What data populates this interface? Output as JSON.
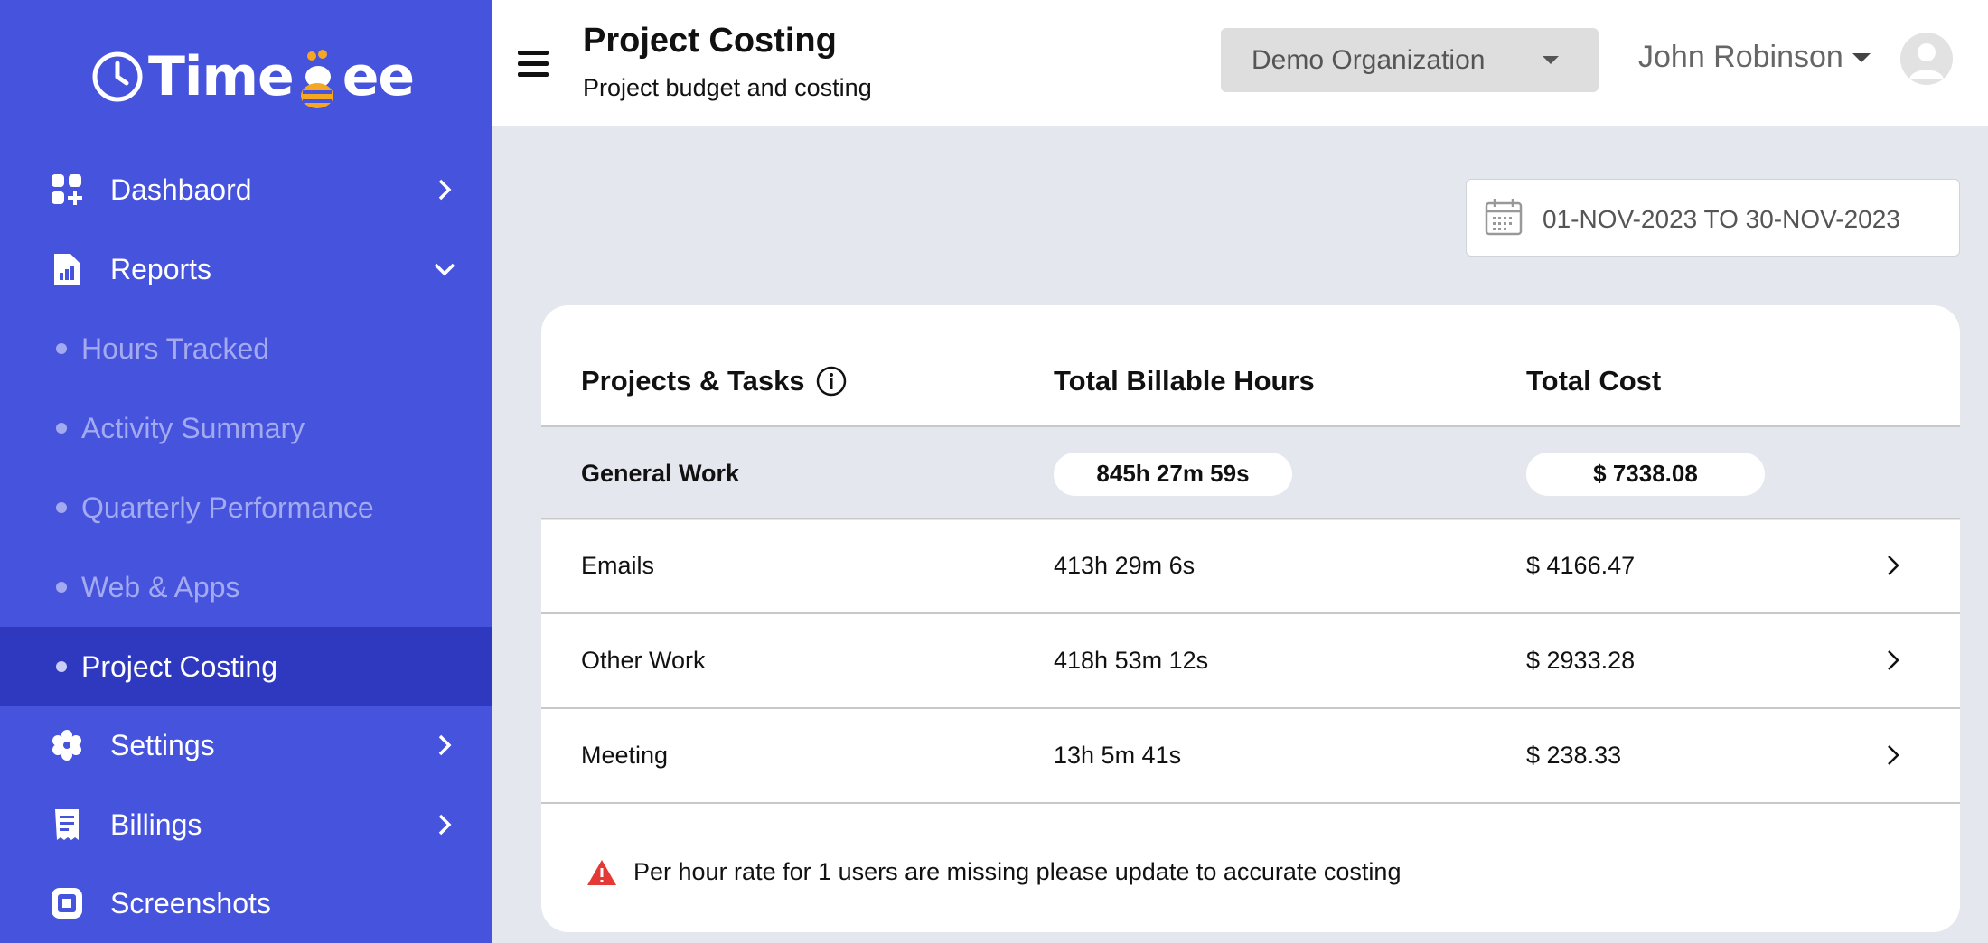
{
  "brand": {
    "logo_text_left": "Time",
    "logo_text_right": "ee"
  },
  "sidebar": {
    "items": [
      {
        "label": "Dashbaord",
        "icon": "dashboard-icon"
      },
      {
        "label": "Reports",
        "icon": "report-icon"
      },
      {
        "label": "Hours Tracked"
      },
      {
        "label": "Activity Summary"
      },
      {
        "label": "Quarterly Performance"
      },
      {
        "label": "Web & Apps"
      },
      {
        "label": "Project Costing",
        "active": true
      },
      {
        "label": "Settings",
        "icon": "gear-icon"
      },
      {
        "label": "Billings",
        "icon": "receipt-icon"
      },
      {
        "label": "Screenshots",
        "icon": "screenshot-icon"
      }
    ]
  },
  "header": {
    "title": "Project Costing",
    "subtitle": "Project budget and costing",
    "organization": "Demo Organization",
    "user_name": "John Robinson"
  },
  "date_range": "01-NOV-2023 TO 30-NOV-2023",
  "table": {
    "headers": {
      "projects": "Projects & Tasks",
      "hours": "Total Billable Hours",
      "cost": "Total Cost"
    },
    "group": {
      "name": "General Work",
      "hours": "845h 27m 59s",
      "cost": "$ 7338.08"
    },
    "rows": [
      {
        "name": "Emails",
        "hours": "413h 29m 6s",
        "cost": "$ 4166.47"
      },
      {
        "name": "Other Work",
        "hours": "418h 53m 12s",
        "cost": "$ 2933.28"
      },
      {
        "name": "Meeting",
        "hours": "13h 5m 41s",
        "cost": "$ 238.33"
      }
    ]
  },
  "warning": "Per hour rate for 1 users are missing please update to accurate costing",
  "colors": {
    "sidebar": "#4653dc",
    "sidebar_active": "#2f39c0",
    "background": "#e4e7ee",
    "warning": "#e53935"
  }
}
